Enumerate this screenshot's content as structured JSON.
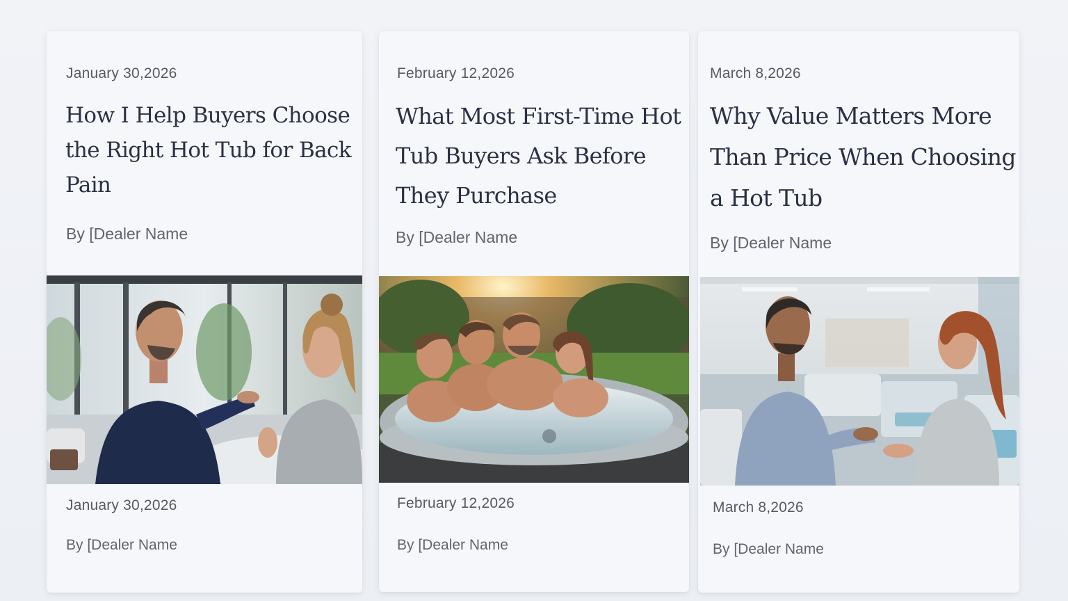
{
  "posts": [
    {
      "date_top": "January 30,2026",
      "title": "How I Help Buyers Choose the Right Hot Tub for Back Pain",
      "author_top": "By [Dealer Name",
      "image_icon": "showroom-consultation-photo",
      "date_bottom": "January 30,2026",
      "author_bottom": "By [Dealer Name"
    },
    {
      "date_top": "February 12,2026",
      "title": "What Most First-Time Hot Tub Buyers Ask Before They Purchase",
      "author_top": "By [Dealer Name",
      "image_icon": "friends-in-hot-tub-photo",
      "date_bottom": "February 12,2026",
      "author_bottom": "By [Dealer Name"
    },
    {
      "date_top": "March 8,2026",
      "title": "Why Value Matters More Than Price When Choosing a Hot Tub",
      "author_top": "By [Dealer Name",
      "image_icon": "dealer-showroom-conversation-photo",
      "date_bottom": "March 8,2026",
      "author_bottom": "By [Dealer Name"
    }
  ],
  "colors": {
    "page_background": "#eef1f5",
    "card_background": "#f6f7fa",
    "title_text": "#2b3144",
    "meta_text": "#565a63"
  }
}
